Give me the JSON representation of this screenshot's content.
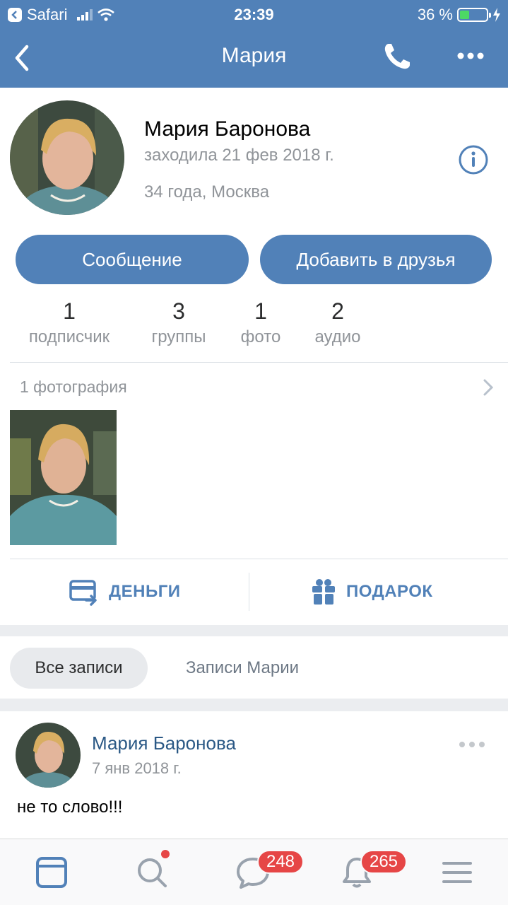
{
  "status_bar": {
    "carrier": "Safari",
    "time": "23:39",
    "battery": "36 %",
    "battery_level": 0.36
  },
  "nav": {
    "title": "Мария",
    "back_icon": "chevron-left-icon",
    "call_icon": "phone-icon",
    "more_icon": "more-horizontal-icon"
  },
  "profile": {
    "name": "Мария Баронова",
    "last_seen": "заходила 21 фев 2018 г.",
    "details": "34 года, Москва",
    "info_icon": "info-icon"
  },
  "buttons": {
    "message": "Сообщение",
    "add_friend": "Добавить в друзья"
  },
  "counters": [
    {
      "value": "1",
      "label": "подписчик"
    },
    {
      "value": "3",
      "label": "группы"
    },
    {
      "value": "1",
      "label": "фото"
    },
    {
      "value": "2",
      "label": "аудио"
    }
  ],
  "photos": {
    "header": "1 фотография"
  },
  "actions": {
    "money": "ДЕНЬГИ",
    "gift": "ПОДАРОК"
  },
  "tabs": {
    "all": "Все записи",
    "own": "Записи Марии"
  },
  "post": {
    "author": "Мария Баронова",
    "date": "7 янв 2018 г.",
    "text": "не то слово!!!"
  },
  "tabbar": {
    "messages_badge": "248",
    "notifications_badge": "265"
  },
  "colors": {
    "accent": "#5181b8",
    "link": "#2a5885",
    "badge": "#e64646",
    "muted": "#909499"
  }
}
